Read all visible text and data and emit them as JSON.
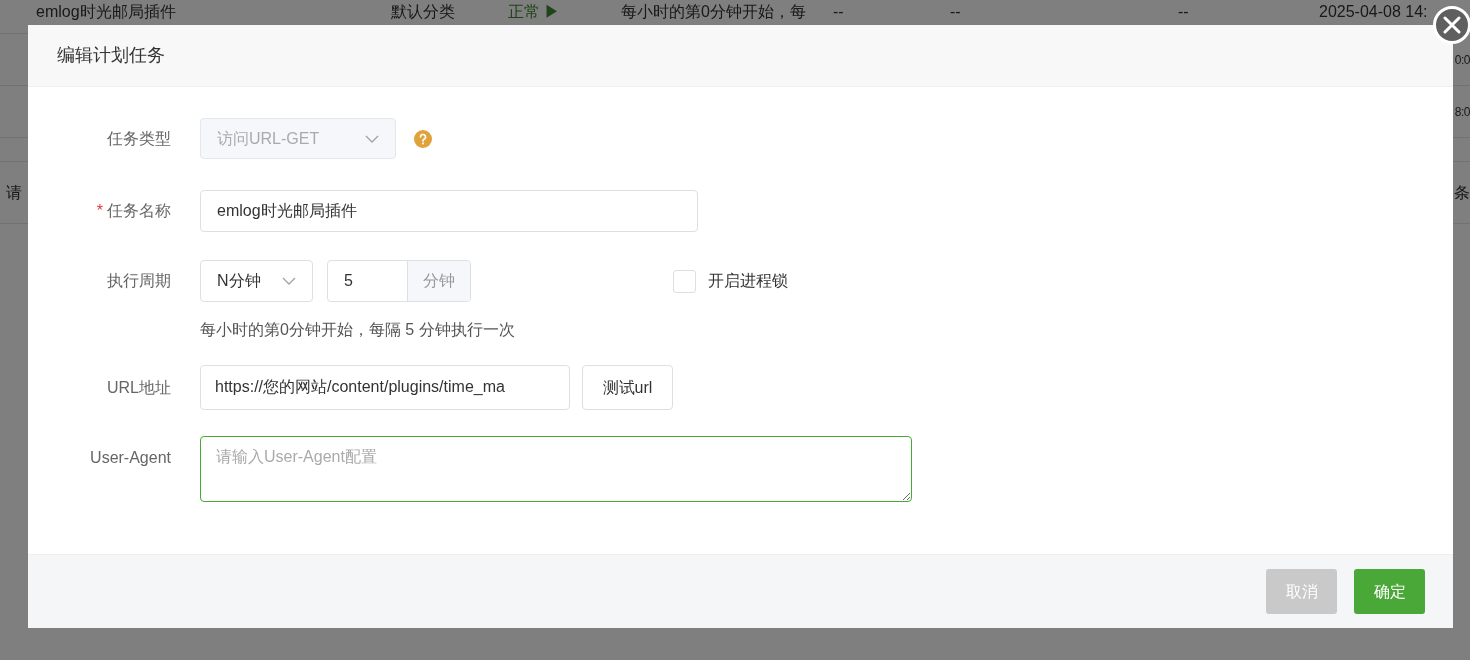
{
  "background_table": {
    "rows": [
      {
        "cells": [
          "emlog时光邮局插件",
          "默认分类",
          "正常 ▶",
          "每小时的第0分钟开始，每",
          "--",
          "--",
          "--",
          "2025-04-08 14:"
        ]
      },
      {
        "cells": [
          "0:0"
        ]
      },
      {
        "cells": [
          "8:0"
        ]
      }
    ],
    "pager": {
      "left": "请",
      "right": "条"
    }
  },
  "dialog": {
    "title": "编辑计划任务",
    "task_type": {
      "label": "任务类型",
      "value": "访问URL-GET",
      "disabled": true
    },
    "task_name": {
      "label": "任务名称",
      "required_mark": "*",
      "value": "emlog时光邮局插件"
    },
    "period": {
      "label": "执行周期",
      "unit_select": "N分钟",
      "value": "5",
      "addon": "分钟",
      "lock": {
        "label": "开启进程锁",
        "checked": false
      },
      "hint": "每小时的第0分钟开始，每隔 5 分钟执行一次"
    },
    "url": {
      "label": "URL地址",
      "value": "https://您的网站/content/plugins/time_ma",
      "test_button": "测试url"
    },
    "user_agent": {
      "label": "User-Agent",
      "placeholder": "请输入User-Agent配置",
      "focused": true
    },
    "buttons": [
      {
        "label": "取消",
        "kind": "secondary"
      },
      {
        "label": "确定",
        "kind": "primary"
      }
    ]
  }
}
